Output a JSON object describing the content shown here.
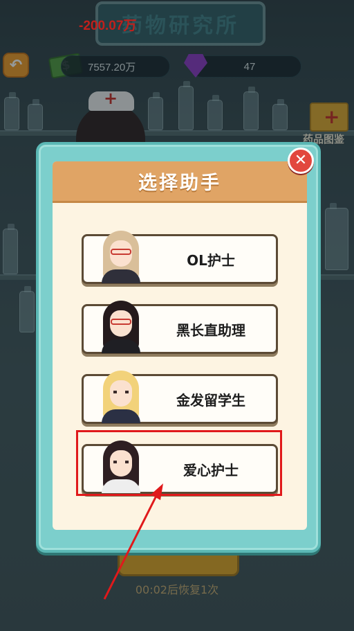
{
  "header": {
    "title": "药物研究所",
    "float_text": "-200.07万"
  },
  "resources": {
    "cash": "7557.20万",
    "gems": "47"
  },
  "side": {
    "catalog_label": "药品图鉴"
  },
  "dialog": {
    "title": "选择助手",
    "options": [
      {
        "label": "OL护士",
        "hair_color": "#d9bf9a",
        "glasses": true
      },
      {
        "label": "黑长直助理",
        "hair_color": "#241a1c",
        "glasses": true
      },
      {
        "label": "金发留学生",
        "hair_color": "#f2d27a",
        "glasses": false
      },
      {
        "label": "爱心护士",
        "hair_color": "#2e1f22",
        "glasses": false
      }
    ]
  },
  "footer": {
    "button_label": "",
    "restore_text": "00:02后恢复1次"
  },
  "annotation": {
    "highlight_color": "#e0191b",
    "highlighted_option": "爱心护士"
  }
}
